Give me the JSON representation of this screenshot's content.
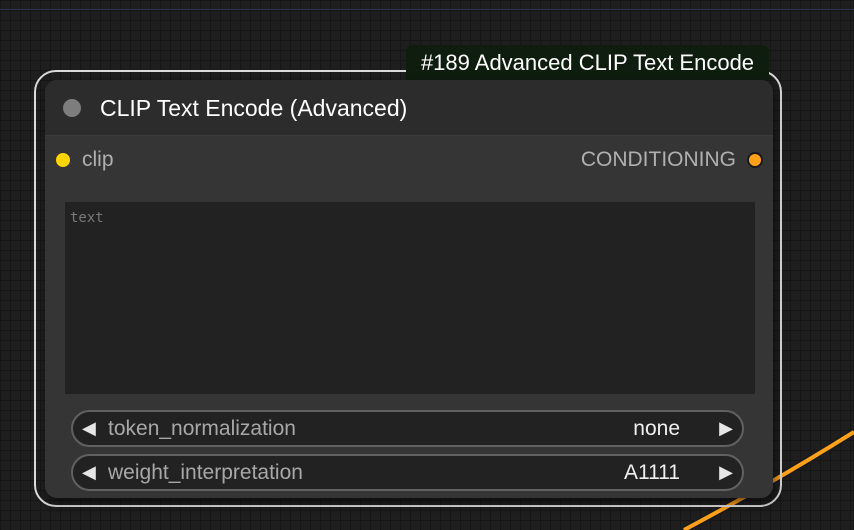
{
  "badge": {
    "text": "#189 Advanced CLIP Text Encode"
  },
  "node": {
    "title": "CLIP Text Encode (Advanced)",
    "input": {
      "label": "clip",
      "color": "#ffd500"
    },
    "output": {
      "label": "CONDITIONING",
      "color": "#ffa01a"
    },
    "text_widget": {
      "placeholder": "text",
      "value": ""
    },
    "widgets": [
      {
        "name": "token_normalization",
        "value": "none"
      },
      {
        "name": "weight_interpretation",
        "value": "A1111"
      }
    ]
  },
  "colors": {
    "canvas": "#1e1e1e",
    "node_body": "#353535",
    "node_header": "#2c2c2c",
    "badge_bg": "#0f1d0f",
    "selection_outline": "#d9d9d9",
    "link": "#ffa01a"
  },
  "icons": {
    "collapse": "collapse-dot-icon",
    "decrement": "triangle-left-icon",
    "increment": "triangle-right-icon"
  }
}
